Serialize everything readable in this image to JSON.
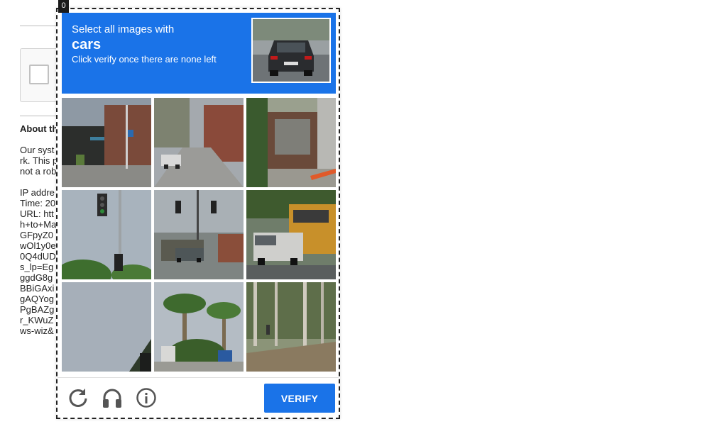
{
  "background_page": {
    "about_heading": "About th",
    "paragraph_lines": [
      "Our syst",
      "rk. This p",
      "not a rob"
    ],
    "info_lines": [
      "IP addre",
      "Time: 20",
      "URL: htt",
      "h+to+Ma",
      "GFpyZ0",
      "wOl1y0e",
      "0Q4dUD",
      "s_lp=Eg",
      "ggdG8g",
      "BBiGAxi",
      "gAQYog",
      "PgBAZg",
      "r_KWuZ",
      "ws-wiz&"
    ]
  },
  "captcha": {
    "badge": "0",
    "header": {
      "line1": "Select all images with",
      "target": "cars",
      "line3": "Click verify once there are none left"
    },
    "tiles": [
      {
        "label": "street corner with sign"
      },
      {
        "label": "alley street with parked car"
      },
      {
        "label": "wooden shed"
      },
      {
        "label": "traffic light"
      },
      {
        "label": "intersection with car"
      },
      {
        "label": "school bus and truck"
      },
      {
        "label": "sky"
      },
      {
        "label": "palm trees"
      },
      {
        "label": "forest path"
      }
    ],
    "footer": {
      "reload_icon": "reload-icon",
      "audio_icon": "headphones-icon",
      "info_icon": "info-icon",
      "verify_label": "VERIFY"
    },
    "colors": {
      "accent": "#1a73e8"
    }
  }
}
